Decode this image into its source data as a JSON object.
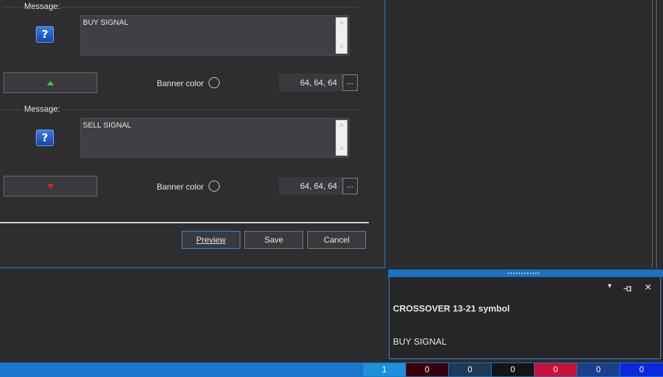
{
  "dialog": {
    "buy": {
      "section_label": "Message:",
      "message": "BUY SIGNAL",
      "banner_color_label": "Banner color",
      "color_value": "64, 64, 64",
      "dots_label": "..."
    },
    "sell": {
      "section_label": "Message:",
      "message": "SELL SIGNAL",
      "banner_color_label": "Banner color",
      "color_value": "64, 64, 64",
      "dots_label": "..."
    },
    "buttons": {
      "preview": "Preview",
      "save": "Save",
      "cancel": "Cancel"
    },
    "help_icon": "question-icon"
  },
  "alert_panel": {
    "title": "CROSSOVER 13-21 symbol",
    "message": "BUY SIGNAL",
    "controls": {
      "dropdown": "▾",
      "close": "✕"
    }
  },
  "status_cells": [
    {
      "label": "1",
      "color": "#1e90d8"
    },
    {
      "label": "0",
      "color": "#3a0008"
    },
    {
      "label": "0",
      "color": "#1f3a55"
    },
    {
      "label": "0",
      "color": "#141414"
    },
    {
      "label": "0",
      "color": "#c8103a"
    },
    {
      "label": "0",
      "color": "#1b3f8a"
    },
    {
      "label": "0",
      "color": "#0a28e0"
    }
  ],
  "colors": {
    "accent": "#1a76c8",
    "buy": "#2ecc40",
    "sell": "#e02020"
  }
}
